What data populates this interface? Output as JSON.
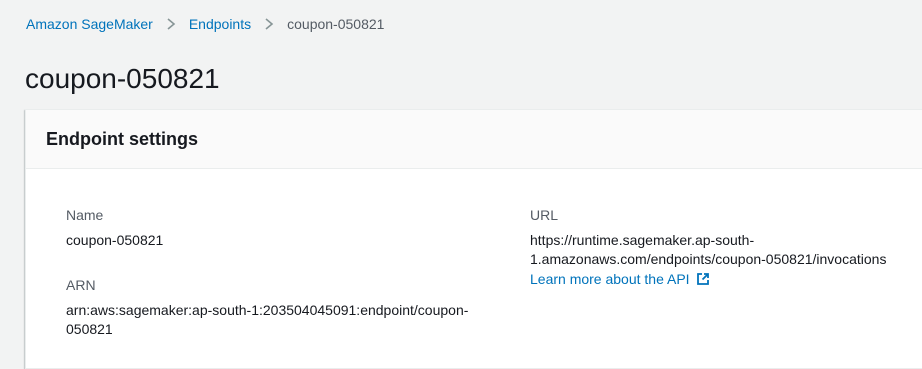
{
  "breadcrumb": {
    "items": [
      "Amazon SageMaker",
      "Endpoints"
    ],
    "current": "coupon-050821"
  },
  "page": {
    "title": "coupon-050821"
  },
  "settings": {
    "title": "Endpoint settings",
    "name_label": "Name",
    "name_value": "coupon-050821",
    "arn_label": "ARN",
    "arn_value_line1": "arn:aws:sagemaker:ap-south-1:203504045091:endpoint/coupon-",
    "arn_value_line2": "050821",
    "url_label": "URL",
    "url_value_line1": "https://runtime.sagemaker.ap-south-",
    "url_value_line2": "1.amazonaws.com/endpoints/coupon-050821/invocations",
    "learn_more": "Learn more about the API"
  },
  "icons": {
    "separator": "chevron-right-icon",
    "external": "external-link-icon"
  },
  "colors": {
    "link": "#0073bb",
    "background": "#f2f3f3"
  }
}
